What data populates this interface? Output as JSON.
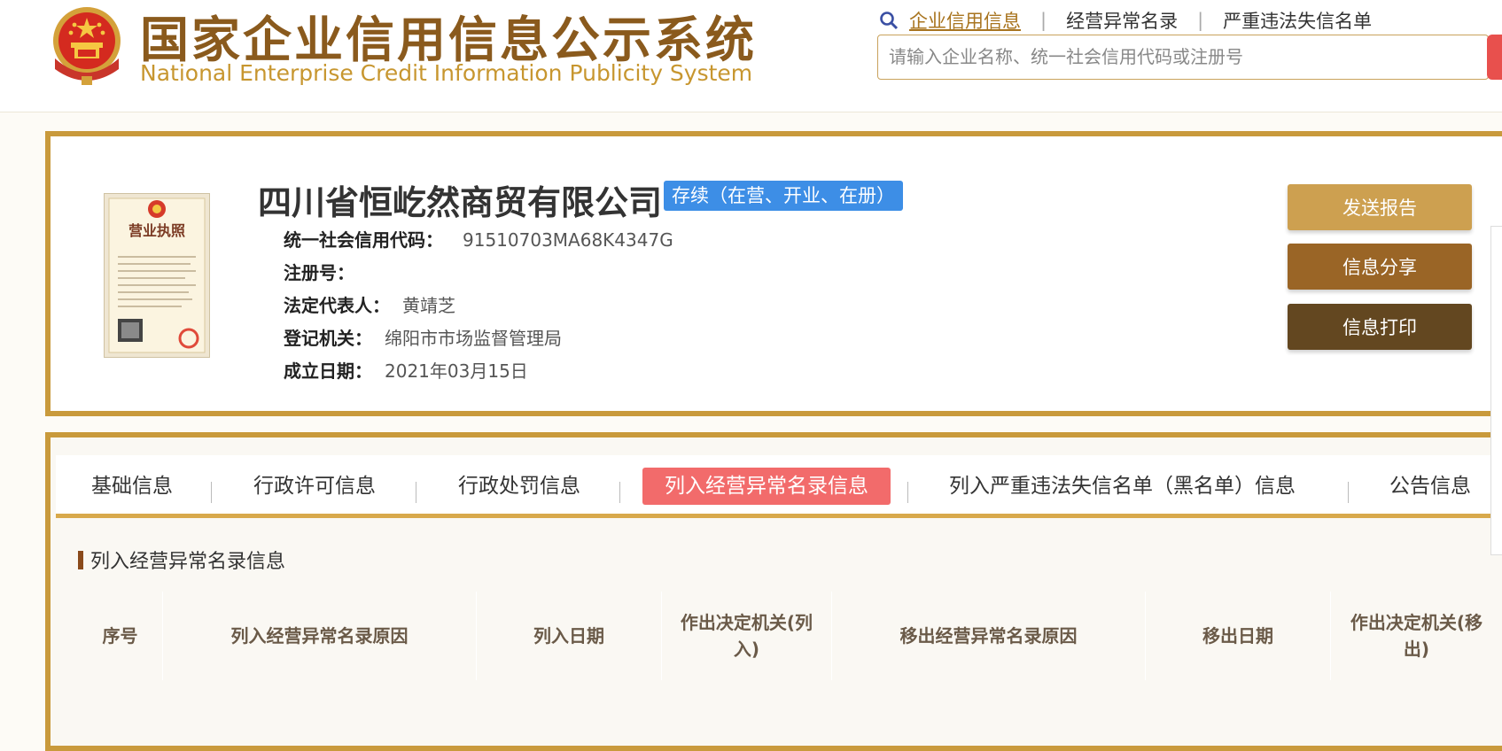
{
  "header": {
    "title_cn": "国家企业信用信息公示系统",
    "title_en": "National Enterprise Credit Information Publicity System",
    "nav": [
      "企业信用信息",
      "经营异常名录",
      "严重违法失信名单"
    ],
    "search_placeholder": "请输入企业名称、统一社会信用代码或注册号"
  },
  "company": {
    "name": "四川省恒屹然商贸有限公司",
    "status": "存续（在营、开业、在册）",
    "license_title": "营业执照",
    "fields": [
      {
        "label": "统一社会信用代码：",
        "value": "91510703MA68K4347G"
      },
      {
        "label": "注册号：",
        "value": ""
      },
      {
        "label": "法定代表人：",
        "value": "黄靖芝"
      },
      {
        "label": "登记机关：",
        "value": "绵阳市市场监督管理局"
      },
      {
        "label": "成立日期：",
        "value": "2021年03月15日"
      }
    ],
    "buttons": [
      "发送报告",
      "信息分享",
      "信息打印"
    ]
  },
  "tabs": [
    "基础信息",
    "行政许可信息",
    "行政处罚信息",
    "列入经营异常名录信息",
    "列入严重违法失信名单（黑名单）信息",
    "公告信息"
  ],
  "active_tab": "列入经营异常名录信息",
  "section": {
    "title": "列入经营异常名录信息",
    "columns": [
      "序号",
      "列入经营异常名录原因",
      "列入日期",
      "作出决定机关(列入)",
      "移出经营异常名录原因",
      "移出日期",
      "作出决定机关(移出)"
    ]
  },
  "colors": {
    "brand": "#8a5a1d",
    "border_gold": "#c99a3c",
    "active_tab": "#f26b6b",
    "status_blue": "#3d8ee6",
    "btn_send": "#cda050",
    "btn_share": "#9a6526",
    "btn_print": "#634720"
  }
}
